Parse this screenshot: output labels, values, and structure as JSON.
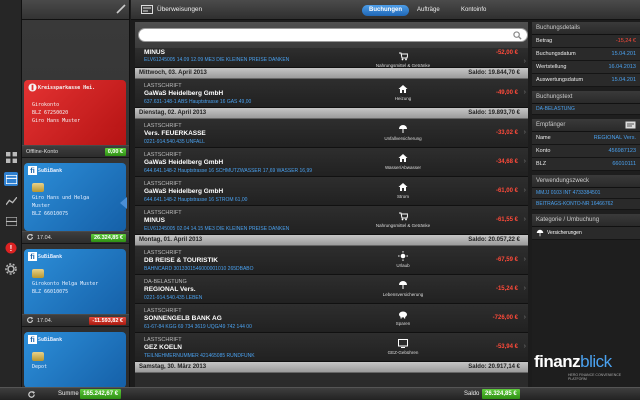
{
  "topbar": {
    "title": "Überweisungen",
    "tabs": [
      {
        "label": "Buchungen",
        "active": true
      },
      {
        "label": "Aufträge",
        "active": false
      },
      {
        "label": "Kontoinfo",
        "active": false
      }
    ]
  },
  "accounts": {
    "offline_label": "Offline-Konto",
    "offline_balance": "0,00 €",
    "cards": [
      {
        "bank": "Kreissparkasse Hei.",
        "color": "red",
        "line1": "Girokonto",
        "line2": "BLZ 67250020",
        "line3": "Giro Hans Muster"
      },
      {
        "bank": "SuBiBank",
        "color": "blue",
        "line1": "Giro Hans und Helga",
        "line2": "Muster",
        "line3": "BLZ 66010075"
      },
      {
        "bank": "SuBiBank",
        "color": "blue",
        "line1": "Girokonto Helga Muster",
        "line2": "BLZ 66010075",
        "line3": ""
      },
      {
        "bank": "SuBiBank",
        "color": "blue",
        "line1": "Depot",
        "line2": "",
        "line3": ""
      }
    ],
    "card_bars": [
      {
        "date": "17.04.",
        "balance": "26.324,85 €",
        "positive": true
      },
      {
        "date": "17.04.",
        "balance": "-11.593,82 €",
        "positive": false
      }
    ]
  },
  "list": {
    "search_placeholder": "",
    "entries": [
      {
        "kind": "tx",
        "partial": true,
        "type": "",
        "name": "MINUS",
        "desc": "ELV61245005 14.09 12.09 ME3 DIE KLEINEN PREISE DANKEN",
        "category": "Nahrungsmittel & Getränke",
        "icon": "cart-icon",
        "amount": "-52,00 €"
      },
      {
        "kind": "day",
        "date": "Mittwoch, 03. April 2013",
        "saldo": "Saldo: 19.844,70 €"
      },
      {
        "kind": "tx",
        "type": "LASTSCHRIFT",
        "name": "GaWaS Heidelberg GmbH",
        "desc": "637.631-148-1 ABS Hauptstrasse 16 GAS 49,00",
        "category": "Heizung",
        "icon": "house-icon",
        "amount": "-49,00 €"
      },
      {
        "kind": "day",
        "date": "Dienstag, 02. April 2013",
        "saldo": "Saldo: 19.893,70 €"
      },
      {
        "kind": "tx",
        "type": "LASTSCHRIFT",
        "name": "Vers. FEUERKASSE",
        "desc": "0221-914.540.435 UNFALL",
        "category": "Unfallversicherung",
        "icon": "umbrella-icon",
        "amount": "-33,02 €"
      },
      {
        "kind": "tx",
        "type": "LASTSCHRIFT",
        "name": "GaWaS Heidelberg GmbH",
        "desc": "644.641.148-2 Hauptstrasse 16 SCHMUTZWASSER 17,69 WASSER 16,99",
        "category": "Wasser/Abwasser",
        "icon": "house-icon",
        "amount": "-34,68 €"
      },
      {
        "kind": "tx",
        "type": "LASTSCHRIFT",
        "name": "GaWaS Heidelberg GmbH",
        "desc": "644.641.148-2 Hauptstrasse 16 STROM 61,00",
        "category": "Strom",
        "icon": "house-icon",
        "amount": "-61,00 €"
      },
      {
        "kind": "tx",
        "type": "LASTSCHRIFT",
        "name": "MINUS",
        "desc": "ELV61245005 02.04 14.15 ME3 DIE KLEINEN PREISE DANKEN",
        "category": "Nahrungsmittel & Getränke",
        "icon": "cart-icon",
        "amount": "-61,55 €"
      },
      {
        "kind": "day",
        "date": "Montag, 01. April 2013",
        "saldo": "Saldo: 20.057,22 €"
      },
      {
        "kind": "tx",
        "type": "LASTSCHRIFT",
        "name": "DB REISE & TOURISTIK",
        "desc": "BAHNCARD 3013301546000001010 265DBABO",
        "category": "Urlaub",
        "icon": "sun-icon",
        "amount": "-67,59 €"
      },
      {
        "kind": "tx",
        "type": "DA-BELASTUNG",
        "name": "REGIONAL Vers.",
        "desc": "0221-914.540.435 LEBEN",
        "category": "Lebensversicherung",
        "icon": "umbrella-icon",
        "amount": "-15,24 €"
      },
      {
        "kind": "tx",
        "type": "LASTSCHRIFT",
        "name": "SONNENGELB BANK AG",
        "desc": "61-67-84 KGG 69 734 3619 UQG/49 742 144 00",
        "category": "Sparen",
        "icon": "piggy-icon",
        "amount": "-726,00 €"
      },
      {
        "kind": "tx",
        "type": "LASTSCHRIFT",
        "name": "GEZ KOELN",
        "desc": "TEILNEHMERNUMMER 421465085 RUNDFUNK",
        "category": "GEZ-Gebühren",
        "icon": "tv-icon",
        "amount": "-53,94 €"
      },
      {
        "kind": "day",
        "date": "Samstag, 30. März 2013",
        "saldo": "Saldo: 20.917,14 €"
      }
    ]
  },
  "detail": {
    "buchungsdetails_title": "Buchungsdetails",
    "rows": [
      {
        "key": "Betrag",
        "value": "-15,24 €",
        "blue": false
      },
      {
        "key": "Buchungsdatum",
        "value": "15.04.201",
        "blue": true
      },
      {
        "key": "Wertstellung",
        "value": "16.04.2013",
        "blue": true
      },
      {
        "key": "Auswertungsdatum",
        "value": "15.04.201",
        "blue": true
      }
    ],
    "buchungstext_title": "Buchungstext",
    "buchungstext": "DA-BELASTUNG",
    "empfaenger_title": "Empfänger",
    "empfaenger_rows": [
      {
        "key": "Name",
        "value": "REGIONAL Vers."
      },
      {
        "key": "Konto",
        "value": "456987123"
      },
      {
        "key": "BLZ",
        "value": "66010111"
      }
    ],
    "verwendungszweck_title": "Verwendungszweck",
    "verwendungszweck_1": "MMJJ 0103 INT 4733384501",
    "verwendungszweck_2": "BEITRAGS-KONTO-NR 16466762",
    "kategorie_title": "Kategorie / Umbuchung",
    "kategorie": "Versicherungen"
  },
  "brand": {
    "name_a": "finanz",
    "name_b": "blick",
    "tagline": "HERO FINANCE CONVENIENCE PLATFORM"
  },
  "bottombar": {
    "summe_label": "Summe",
    "summe_value": "165.242,67 €",
    "saldo_label": "Saldo",
    "saldo_value": "26.324,85 €"
  },
  "colors": {
    "accent": "#2f80d0",
    "negative": "#ff4a3a",
    "positive": "#3da81c"
  }
}
